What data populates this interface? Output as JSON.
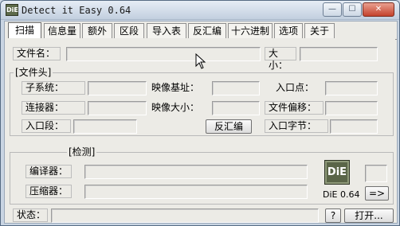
{
  "window": {
    "title": "Detect it Easy 0.64",
    "icon_text": "DiE",
    "minimize_glyph": "—",
    "maximize_glyph": "☐",
    "close_glyph": "✕"
  },
  "tabs": [
    {
      "label": "扫描"
    },
    {
      "label": "信息量"
    },
    {
      "label": "额外"
    },
    {
      "label": "区段"
    },
    {
      "label": "导入表"
    },
    {
      "label": "反汇编"
    },
    {
      "label": "十六进制"
    },
    {
      "label": "选项"
    },
    {
      "label": "关于"
    }
  ],
  "file": {
    "name_label": "文件名：",
    "name_value": "",
    "size_label": "大小：",
    "size_value": ""
  },
  "header_group": {
    "title": "[文件头]",
    "subsystem_label": "子系统：",
    "image_base_label": "映像基址：",
    "entry_point_label": "入口点：",
    "linker_label": "连接器：",
    "image_size_label": "映像大小：",
    "file_offset_label": "文件偏移：",
    "entry_section_label": "入口段：",
    "disasm_button": "反汇编",
    "entry_bytes_label": "入口字节："
  },
  "detect_group": {
    "title": "[检测]",
    "compiler_label": "编译器：",
    "packer_label": "压缩器：",
    "die_logo_text": "DiE",
    "die_version": "DiE 0.64",
    "arrow_button": "=>"
  },
  "status": {
    "label": "状态：",
    "value": "",
    "help_button": "?",
    "open_button": "打开..."
  }
}
